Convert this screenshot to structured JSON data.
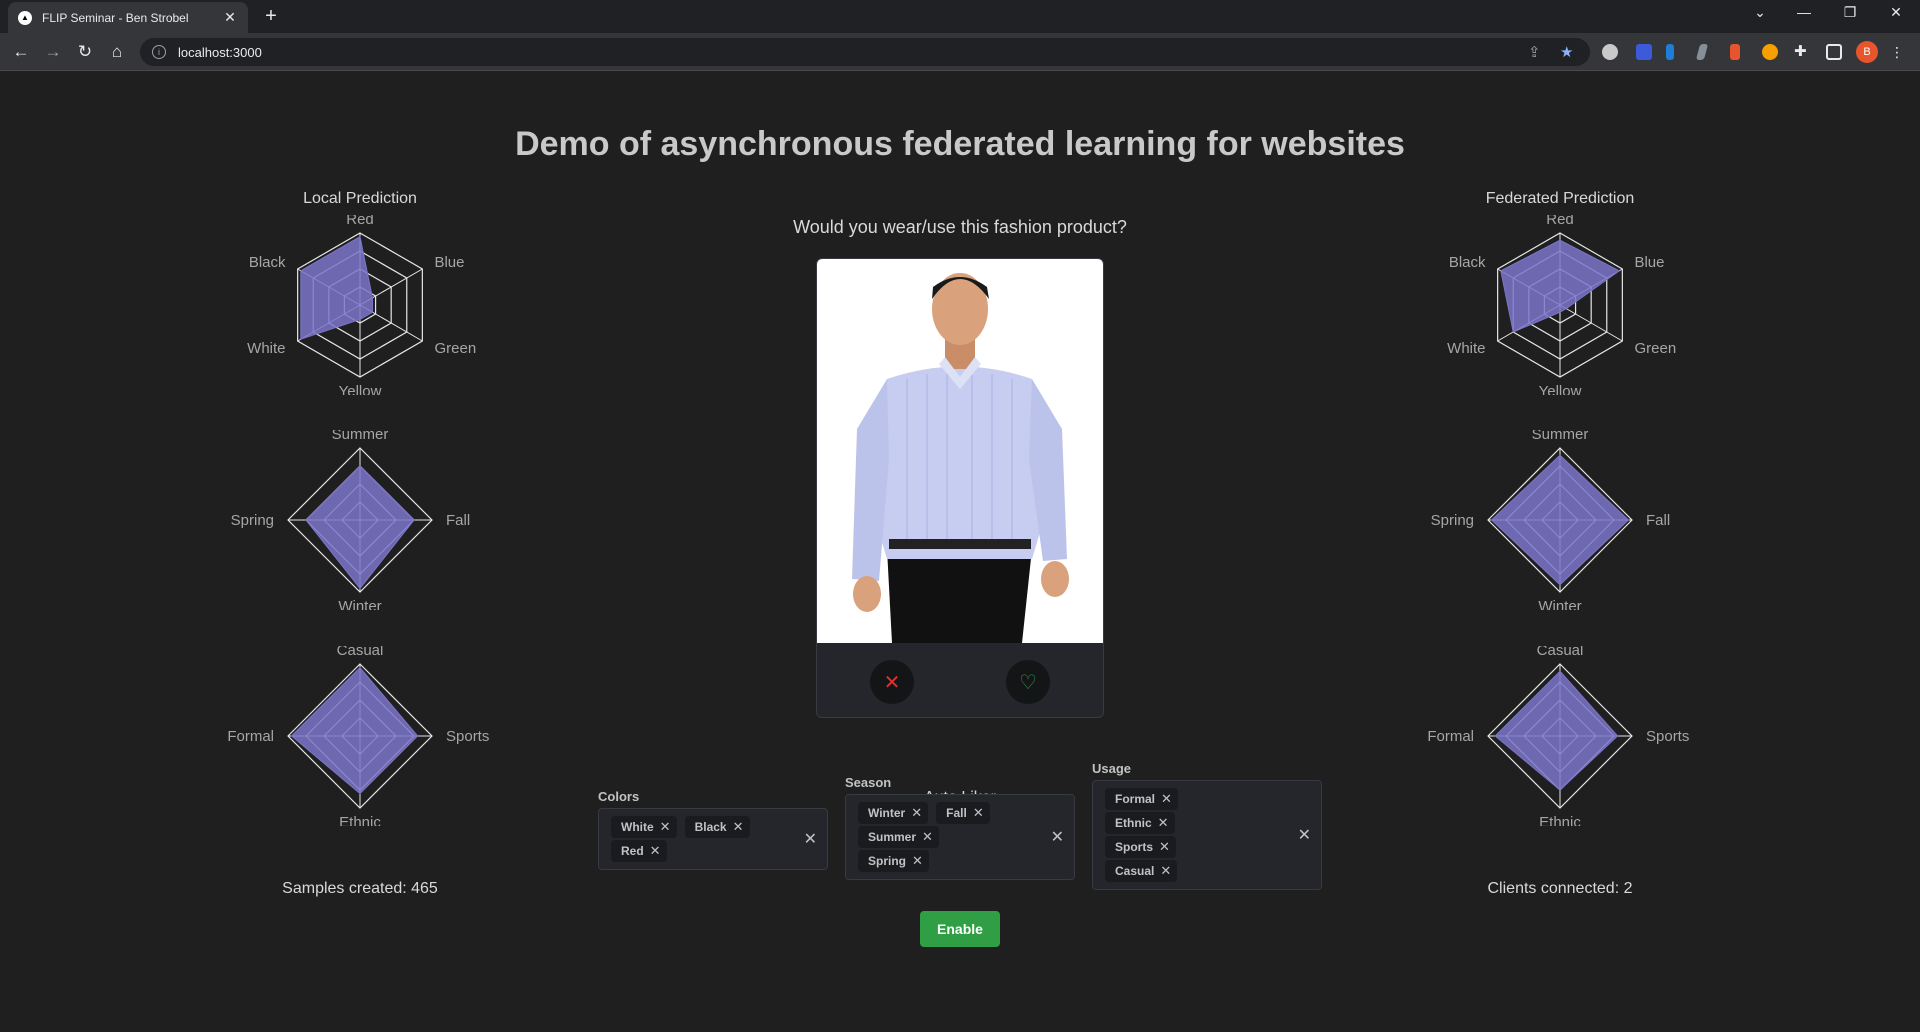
{
  "browser": {
    "tab_title": "FLIP Seminar - Ben Strobel",
    "url": "localhost:3000",
    "profile_initial": "B"
  },
  "page": {
    "title": "Demo of asynchronous federated learning for websites",
    "question": "Would you wear/use this fashion product?"
  },
  "local": {
    "title": "Local Prediction",
    "stat": "Samples created: 465"
  },
  "federated": {
    "title": "Federated Prediction",
    "stat": "Clients connected: 2"
  },
  "chart_data": [
    {
      "type": "radar",
      "panel": "Local Prediction",
      "group": "colors",
      "axes": [
        "Red",
        "Blue",
        "Green",
        "Yellow",
        "White",
        "Black"
      ],
      "values": [
        0.95,
        0.2,
        0.2,
        0.2,
        0.95,
        0.95
      ],
      "range": [
        0,
        1
      ]
    },
    {
      "type": "radar",
      "panel": "Local Prediction",
      "group": "season",
      "axes": [
        "Summer",
        "Fall",
        "Winter",
        "Spring"
      ],
      "values": [
        0.75,
        0.75,
        0.95,
        0.75
      ],
      "range": [
        0,
        1
      ]
    },
    {
      "type": "radar",
      "panel": "Local Prediction",
      "group": "usage",
      "axes": [
        "Casual",
        "Sports",
        "Ethnic",
        "Formal"
      ],
      "values": [
        0.95,
        0.8,
        0.8,
        0.95
      ],
      "range": [
        0,
        1
      ]
    },
    {
      "type": "radar",
      "panel": "Federated Prediction",
      "group": "colors",
      "axes": [
        "Red",
        "Blue",
        "Green",
        "Yellow",
        "White",
        "Black"
      ],
      "values": [
        0.9,
        0.95,
        0.1,
        0.1,
        0.75,
        0.95
      ],
      "range": [
        0,
        1
      ]
    },
    {
      "type": "radar",
      "panel": "Federated Prediction",
      "group": "season",
      "axes": [
        "Summer",
        "Fall",
        "Winter",
        "Spring"
      ],
      "values": [
        0.9,
        0.95,
        0.9,
        0.95
      ],
      "range": [
        0,
        1
      ]
    },
    {
      "type": "radar",
      "panel": "Federated Prediction",
      "group": "usage",
      "axes": [
        "Casual",
        "Sports",
        "Ethnic",
        "Formal"
      ],
      "values": [
        0.9,
        0.8,
        0.75,
        0.9
      ],
      "range": [
        0,
        1
      ]
    }
  ],
  "auto_liker": {
    "title": "Auto Liker",
    "colors": {
      "label": "Colors",
      "rows": [
        [
          "White",
          "Black"
        ],
        [
          "Red"
        ]
      ]
    },
    "season": {
      "label": "Season",
      "rows": [
        [
          "Winter",
          "Fall"
        ],
        [
          "Summer"
        ],
        [
          "Spring"
        ]
      ]
    },
    "usage": {
      "label": "Usage",
      "rows": [
        [
          "Formal"
        ],
        [
          "Ethnic"
        ],
        [
          "Sports"
        ],
        [
          "Casual"
        ]
      ]
    },
    "enable_label": "Enable"
  },
  "colors": {
    "radar_fill": "#7b75c9",
    "enable": "#2f9e44",
    "dislike": "#e03131",
    "like": "#2f9e44"
  }
}
